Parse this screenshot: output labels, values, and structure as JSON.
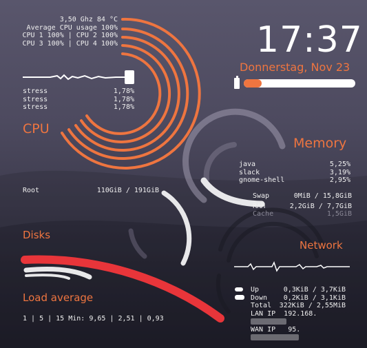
{
  "colors": {
    "accent": "#ee7540",
    "disk_bar": "#e8353a",
    "bar_white": "#e8e8ea"
  },
  "cpu": {
    "freq_line": "3,50 Ghz  84 °C",
    "avg_line": "Average CPU usage 100%",
    "cores_line1": "CPU 1 100% | CPU 2 100%",
    "cores_line2": "CPU 3 100% | CPU 4 100%",
    "processes": [
      {
        "name": "stress",
        "value": "1,78%"
      },
      {
        "name": "stress",
        "value": "1,78%"
      },
      {
        "name": "stress",
        "value": "1,78%"
      }
    ],
    "heading": "CPU"
  },
  "clock": {
    "time": "17:37",
    "date": "Donnerstag, Nov 23",
    "battery_icon": "battery-icon"
  },
  "memory": {
    "heading": "Memory",
    "processes": [
      {
        "name": "java",
        "value": "5,25%"
      },
      {
        "name": "slack",
        "value": "3,19%"
      },
      {
        "name": "gnome-shell",
        "value": "2,95%"
      }
    ],
    "swap_label": "Swap",
    "swap_value": "0MiB / 15,8GiB",
    "ram_label": "RAM",
    "ram_value": "2,2GiB /  7,7GiB",
    "cache_label": "Cache",
    "cache_value": "1,5GiB"
  },
  "disks": {
    "heading": "Disks",
    "root_label": "Root",
    "root_value": "110GiB /  191GiB"
  },
  "load": {
    "heading": "Load average",
    "line": "1 | 5 | 15 Min: 9,65 | 2,51 | 0,93"
  },
  "network": {
    "heading": "Network",
    "up_label": "Up",
    "up_value": "0,3KiB /  3,7KiB",
    "down_label": "Down",
    "down_value": "0,2KiB /  3,1KiB",
    "total_label": "Total",
    "total_value": "322KiB / 2,55MiB",
    "lan_label": "LAN IP",
    "lan_value": "192.168.",
    "wan_label": "WAN IP",
    "wan_value": "95."
  }
}
